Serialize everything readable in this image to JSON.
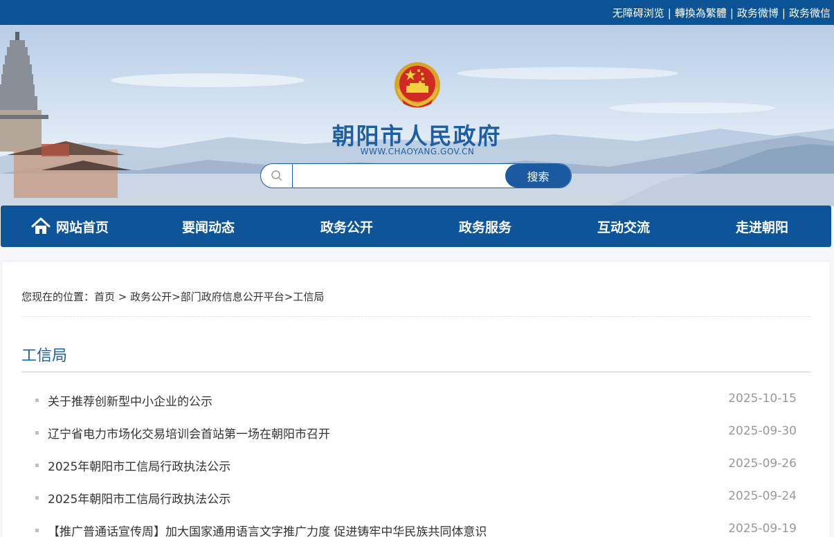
{
  "topbar": {
    "links": [
      "无障碍浏览",
      "轉換為繁體",
      "政务微博",
      "政务微信"
    ],
    "separator": "|"
  },
  "header": {
    "title": "朝阳市人民政府",
    "url": "WWW.CHAOYANG.GOV.CN",
    "emblem_icon": "national-emblem-icon"
  },
  "search": {
    "value": "",
    "placeholder": "",
    "button_label": "搜索",
    "icon": "search-icon"
  },
  "nav": {
    "items": [
      "网站首页",
      "要闻动态",
      "政务公开",
      "政务服务",
      "互动交流",
      "走进朝阳"
    ],
    "home_icon": "home-icon"
  },
  "breadcrumb": {
    "prefix": "您现在的位置：",
    "home": "首页",
    "arrow": " > ",
    "level1": "政务公开",
    "gt": ">",
    "level2": "部门政府信息公开平台",
    "current": "工信局"
  },
  "section": {
    "title": "工信局",
    "items": [
      {
        "title": "关于推荐创新型中小企业的公示",
        "date": "2025-10-15"
      },
      {
        "title": "辽宁省电力市场化交易培训会首站第一场在朝阳市召开",
        "date": "2025-09-30"
      },
      {
        "title": "2025年朝阳市工信局行政执法公示",
        "date": "2025-09-26"
      },
      {
        "title": "2025年朝阳市工信局行政执法公示",
        "date": "2025-09-24"
      },
      {
        "title": "【推广普通话宣传周】加大国家通用语言文字推广力度 促进铸牢中华民族共同体意识",
        "date": "2025-09-19"
      }
    ]
  },
  "colors": {
    "primary": "#0d5598",
    "title_blue": "#1e5fa3",
    "date_gray": "#999999"
  }
}
